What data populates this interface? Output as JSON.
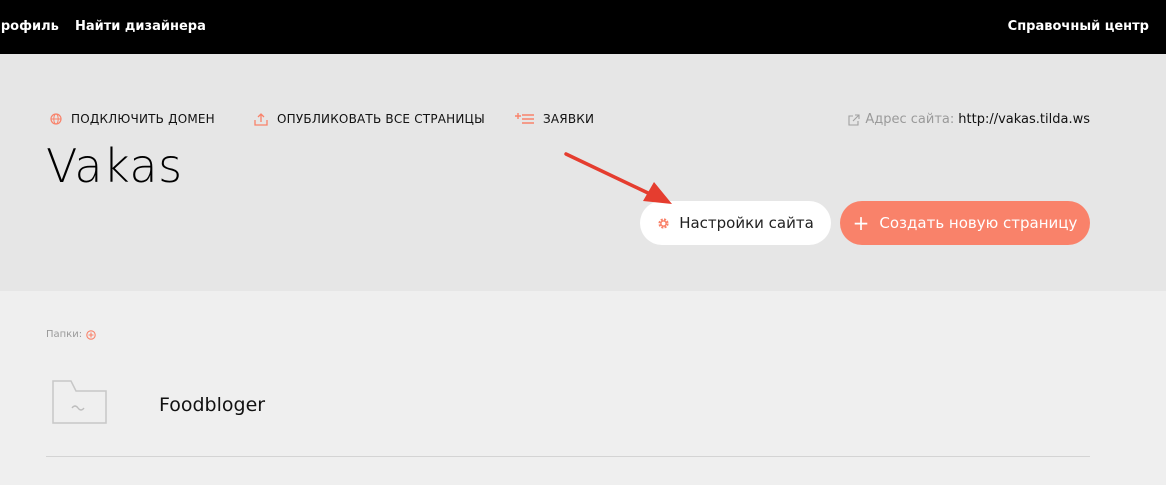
{
  "topbar": {
    "profile_label": "Профиль",
    "find_designer_label": "Найти дизайнера",
    "help_center_label": "Справочный центр"
  },
  "actions": {
    "connect_domain_label": "ПОДКЛЮЧИТЬ ДОМЕН",
    "publish_all_label": "ОПУБЛИКОВАТЬ ВСЕ СТРАНИЦЫ",
    "requests_label": "ЗАЯВКИ"
  },
  "site_address": {
    "label": "Адрес сайта:",
    "url": "http://vakas.tilda.ws"
  },
  "project": {
    "title": "Vakas",
    "settings_button_label": "Настройки сайта",
    "create_page_button_label": "Создать новую страницу"
  },
  "folders": {
    "label": "Папки:",
    "items": [
      {
        "name": "Foodbloger"
      }
    ]
  },
  "colors": {
    "accent": "#f9826a",
    "annotation_arrow": "#e53d2f",
    "topbar_bg": "#000000",
    "header_bg": "#e6e6e6",
    "page_bg": "#efefef"
  },
  "icons": {
    "connect_domain": "globe-icon",
    "publish_all": "upload-icon",
    "requests": "list-plus-icon",
    "site_address": "external-link-icon",
    "settings": "gear-icon",
    "create_page": "plus-icon",
    "add_folder": "plus-circle-icon",
    "folder": "folder-icon"
  }
}
